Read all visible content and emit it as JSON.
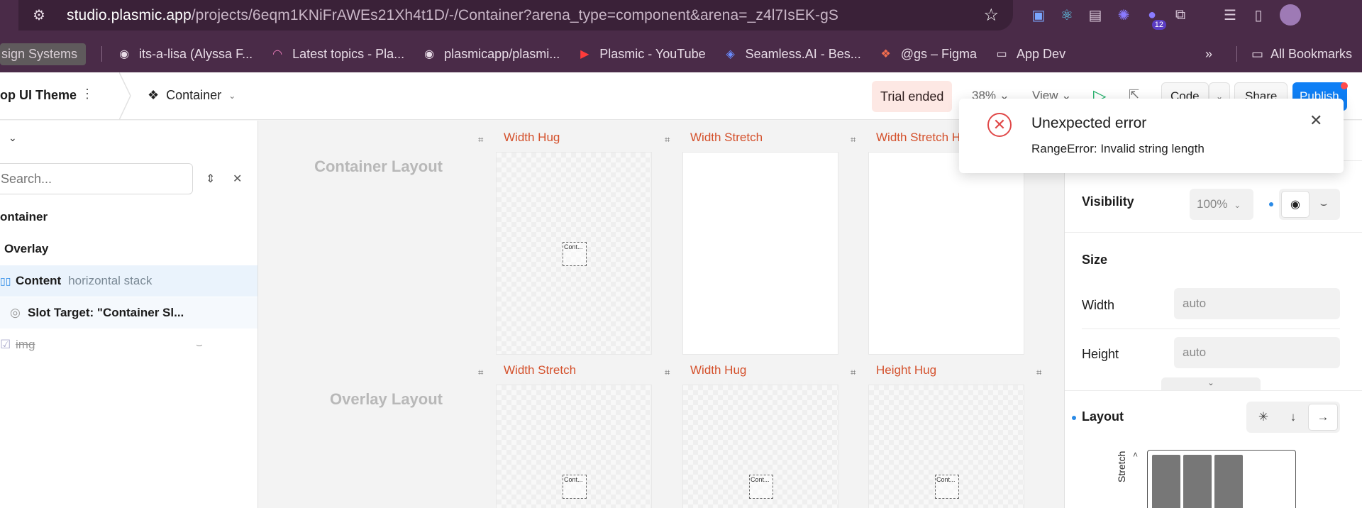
{
  "browser": {
    "url_host": "studio.plasmic.app",
    "url_path": "/projects/6eqm1KNiFrAWEs21Xh4t1D/-/Container?arena_type=component&arena=_z4l7IsEK-gS",
    "extension_badge": "12",
    "bookmarks": [
      {
        "label": "sign Systems",
        "icon": "folder-pill"
      },
      {
        "label": "its-a-lisa (Alyssa F...",
        "icon": "github-icon"
      },
      {
        "label": "Latest topics - Pla...",
        "icon": "rainbow-icon"
      },
      {
        "label": "plasmicapp/plasmi...",
        "icon": "github-icon"
      },
      {
        "label": "Plasmic - YouTube",
        "icon": "youtube-icon"
      },
      {
        "label": "Seamless.AI - Bes...",
        "icon": "seamless-icon"
      },
      {
        "label": "@gs – Figma",
        "icon": "figma-icon"
      },
      {
        "label": "App Dev",
        "icon": "folder-icon"
      }
    ],
    "all_bookmarks": "All Bookmarks",
    "overflow": "»"
  },
  "header": {
    "project_name": "op UI Theme",
    "component_tab": "Container",
    "trial": "Trial ended",
    "zoom": "38%",
    "view": "View",
    "code": "Code",
    "share": "Share",
    "publish": "Publish"
  },
  "left_panel": {
    "search_placeholder": "Search...",
    "tree": [
      {
        "label": "ontainer",
        "sub": ""
      },
      {
        "label": "Overlay",
        "sub": ""
      },
      {
        "label": "Content",
        "sub": "horizontal stack"
      },
      {
        "label": "Slot Target: \"Container Sl...",
        "sub": ""
      },
      {
        "label": "img",
        "sub": ""
      }
    ]
  },
  "canvas": {
    "sections": [
      "Container Layout",
      "Overlay Layout"
    ],
    "row1_frames": [
      "Width Hug",
      "Width Stretch",
      "Width Stretch H"
    ],
    "row2_frames": [
      "Width Stretch",
      "Width Hug",
      "Height Hug"
    ],
    "mini_label": "Cont..."
  },
  "right_panel": {
    "visibility": {
      "label": "Visibility",
      "value": "100%"
    },
    "size": {
      "label": "Size"
    },
    "width": {
      "label": "Width",
      "value": "auto"
    },
    "height": {
      "label": "Height",
      "value": "auto"
    },
    "layout": {
      "label": "Layout"
    },
    "stretch": "Stretch",
    "preview_columns": 3
  },
  "toast": {
    "title": "Unexpected error",
    "message": "RangeError: Invalid string length"
  },
  "colors": {
    "browser_bg": "#4a2b48",
    "accent_blue": "#0f7ff5",
    "frame_title": "#d4502b",
    "error_red": "#e04848",
    "play_green": "#22b06a"
  }
}
